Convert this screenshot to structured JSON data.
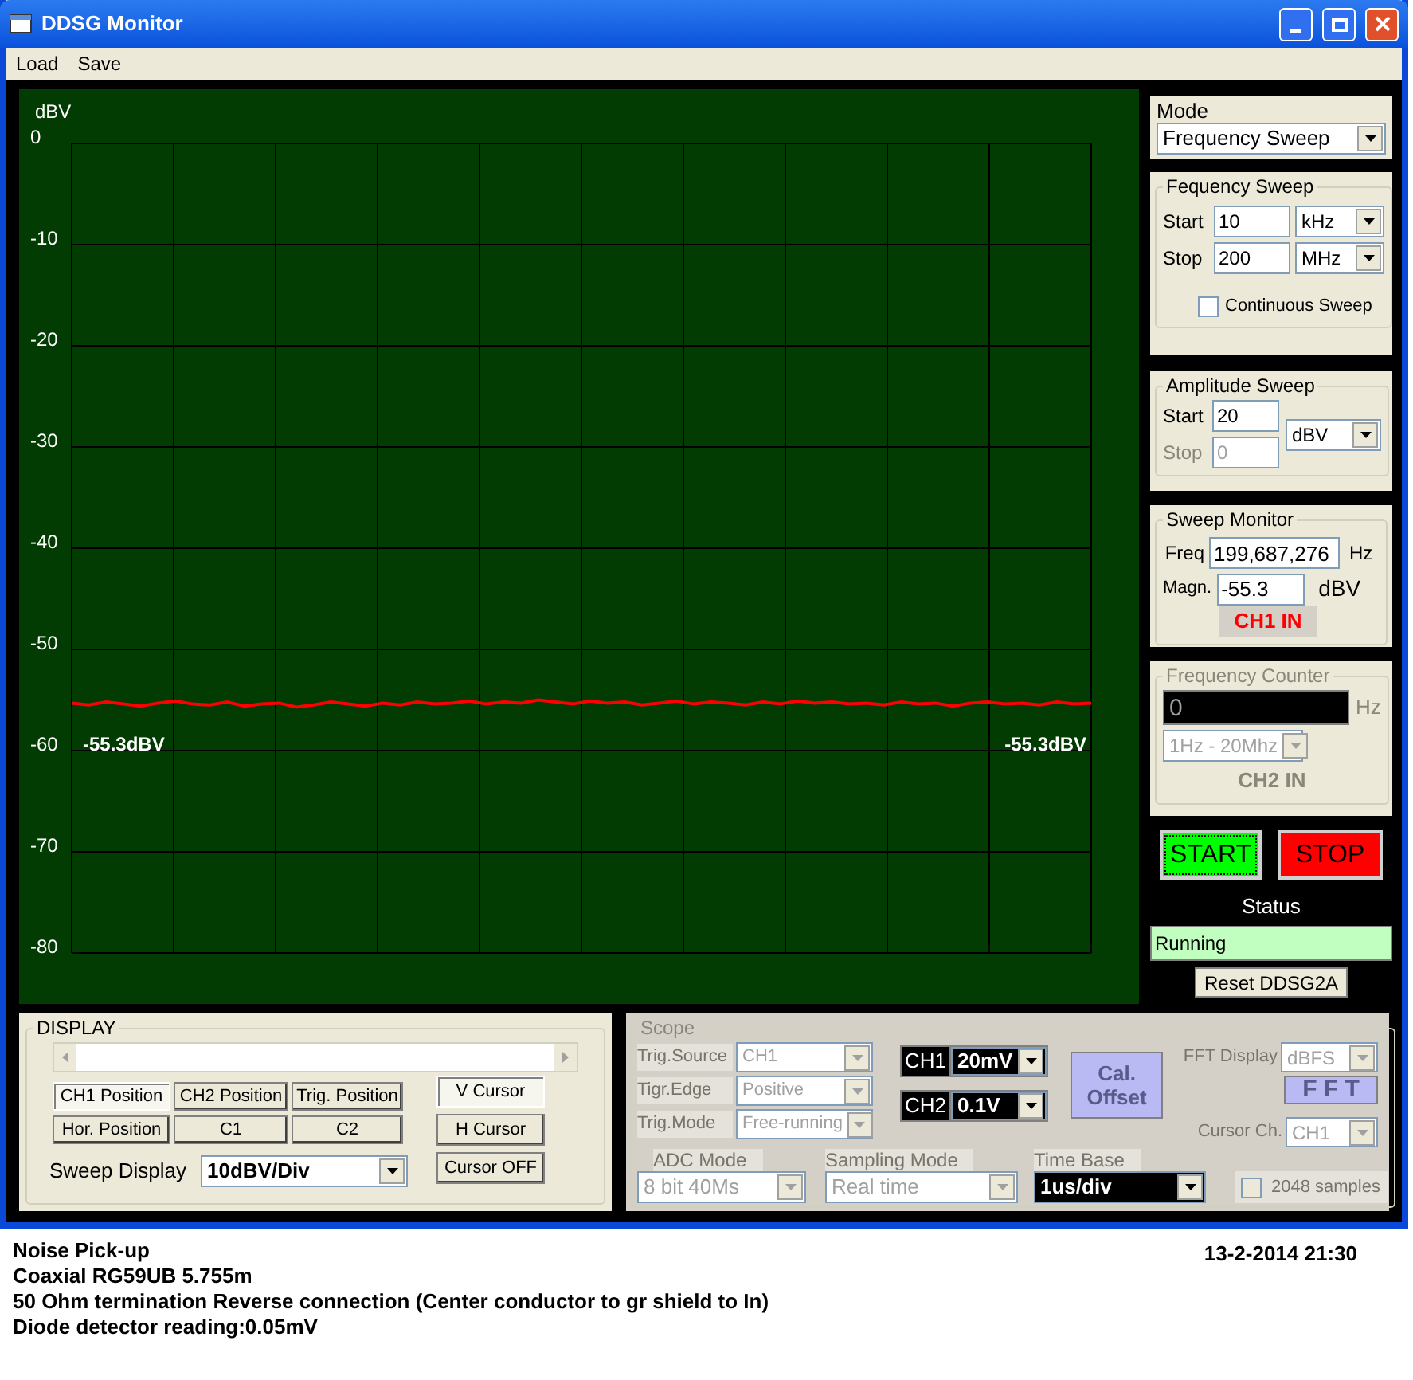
{
  "window": {
    "title": "DDSG Monitor"
  },
  "menu": [
    "Load",
    "Save"
  ],
  "plot": {
    "chart_data": {
      "type": "line",
      "grid": true,
      "ylabel": "dBV",
      "ylim": [
        -80,
        0
      ],
      "yticks": [
        0,
        -10,
        -20,
        -30,
        -40,
        -50,
        -60,
        -70,
        -80
      ],
      "series": [
        {
          "color": "#ff0000",
          "values": [
            -55.3,
            -55.5,
            -55.2,
            -55.4,
            -55.6,
            -55.3,
            -55.1,
            -55.4,
            -55.5,
            -55.2,
            -55.6,
            -55.4,
            -55.3,
            -55.7,
            -55.5,
            -55.2,
            -55.4,
            -55.6,
            -55.3,
            -55.5,
            -55.2,
            -55.4,
            -55.3,
            -55.1,
            -55.4,
            -55.2,
            -55.3,
            -55.0,
            -55.2,
            -55.4,
            -55.1,
            -55.3,
            -55.2,
            -55.5,
            -55.3,
            -55.1,
            -55.4,
            -55.2,
            -55.3,
            -55.5,
            -55.2,
            -55.4,
            -55.1,
            -55.3,
            -55.2,
            -55.4,
            -55.3,
            -55.5,
            -55.2,
            -55.4,
            -55.3,
            -55.6,
            -55.3,
            -55.2,
            -55.4,
            -55.3,
            -55.5,
            -55.2,
            -55.4,
            -55.3
          ]
        }
      ],
      "annotations": [
        "-55.3dBV",
        "-55.3dBV"
      ]
    }
  },
  "mode": {
    "label": "Mode",
    "value": "Frequency Sweep"
  },
  "frequency_sweep": {
    "title": "Fequency Sweep",
    "rows": [
      {
        "label": "Start",
        "value": "10",
        "unit": "kHz"
      },
      {
        "label": "Stop",
        "value": "200",
        "unit": "MHz"
      }
    ],
    "continuous": {
      "label": "Continuous Sweep",
      "checked": false
    }
  },
  "amplitude_sweep": {
    "title": "Amplitude Sweep",
    "start": {
      "label": "Start",
      "value": "20",
      "disabled": false
    },
    "stop": {
      "label": "Stop",
      "value": "0",
      "disabled": true
    },
    "unit": "dBV"
  },
  "sweep_monitor": {
    "title": "Sweep Monitor",
    "freq": {
      "label": "Freq",
      "value": "199,687,276",
      "unit": "Hz"
    },
    "magn": {
      "label": "Magn.",
      "value": "-55.3",
      "unit": "dBV"
    },
    "channel": "CH1 IN"
  },
  "frequency_counter": {
    "title": "Frequency Counter",
    "disabled": true,
    "value": "0",
    "unit": "Hz",
    "range": "1Hz - 20Mhz",
    "channel": "CH2 IN"
  },
  "start_button": "START",
  "stop_button": "STOP",
  "status": {
    "label": "Status",
    "value": "Running"
  },
  "reset_button": "Reset DDSG2A",
  "display": {
    "title": "DISPLAY",
    "position_buttons": [
      {
        "label": "CH1 Position",
        "selected": true
      },
      {
        "label": "CH2 Position",
        "selected": false
      },
      {
        "label": "Trig. Position",
        "selected": false
      },
      {
        "label": "Hor. Position",
        "selected": false
      },
      {
        "label": "C1",
        "selected": false
      },
      {
        "label": "C2",
        "selected": false
      }
    ],
    "cursor_buttons": [
      {
        "label": "V Cursor",
        "selected": true
      },
      {
        "label": "H Cursor",
        "selected": false
      },
      {
        "label": "Cursor OFF",
        "selected": false
      }
    ],
    "sweep_display": {
      "label": "Sweep Display",
      "value": "10dBV/Div"
    }
  },
  "scope": {
    "title": "Scope",
    "disabled": true,
    "trigger": [
      {
        "label": "Trig.Source",
        "value": "CH1"
      },
      {
        "label": "Tigr.Edge",
        "value": "Positive"
      },
      {
        "label": "Trig.Mode",
        "value": "Free-running"
      }
    ],
    "channels": [
      {
        "label": "CH1",
        "value": "20mV"
      },
      {
        "label": "CH2",
        "value": "0.1V"
      }
    ],
    "cal_button": "Cal. Offset",
    "fft_display": {
      "label": "FFT Display",
      "value": "dBFS"
    },
    "fft_button": "F F T",
    "cursor_ch": {
      "label": "Cursor Ch.",
      "value": "CH1"
    },
    "bottom": [
      {
        "label": "ADC Mode",
        "value": "8 bit 40Ms",
        "kind": "combo"
      },
      {
        "label": "Sampling Mode",
        "value": "Real time",
        "kind": "combo"
      },
      {
        "label": "Time Base",
        "value": "1us/div",
        "kind": "dark"
      }
    ],
    "samples": {
      "label": "2048 samples",
      "checked": false
    }
  },
  "notes": {
    "lines": [
      "Noise Pick-up",
      "Coaxial RG59UB 5.755m",
      "50 Ohm termination Reverse connection (Center conductor to gr shield to In)",
      "Diode detector reading:0.05mV"
    ],
    "timestamp": "13-2-2014 21:30"
  }
}
